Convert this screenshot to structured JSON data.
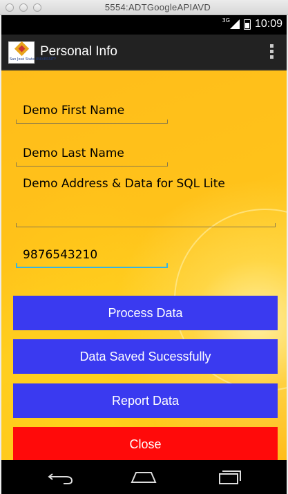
{
  "window": {
    "title": "5554:ADTGoogleAPIAVD"
  },
  "status_bar": {
    "network": "3G",
    "time": "10:09"
  },
  "action_bar": {
    "title": "Personal Info",
    "logo_text": "San José State UNIVERSITY",
    "overflow_icon": "overflow-menu-icon"
  },
  "form": {
    "first_name": "Demo First Name",
    "last_name": "Demo Last Name",
    "address": "Demo Address & Data for SQL Lite",
    "phone": "9876543210"
  },
  "buttons": {
    "process": "Process Data",
    "saved": "Data Saved Sucessfully",
    "report": "Report Data",
    "close": "Close"
  },
  "colors": {
    "button_blue": "#3a3af0",
    "button_red": "#ff0a0a",
    "background": "#ffc21a",
    "focus_underline": "#33b5e5"
  },
  "nav_bar": {
    "icons": [
      "back-icon",
      "home-icon",
      "recent-apps-icon"
    ]
  }
}
